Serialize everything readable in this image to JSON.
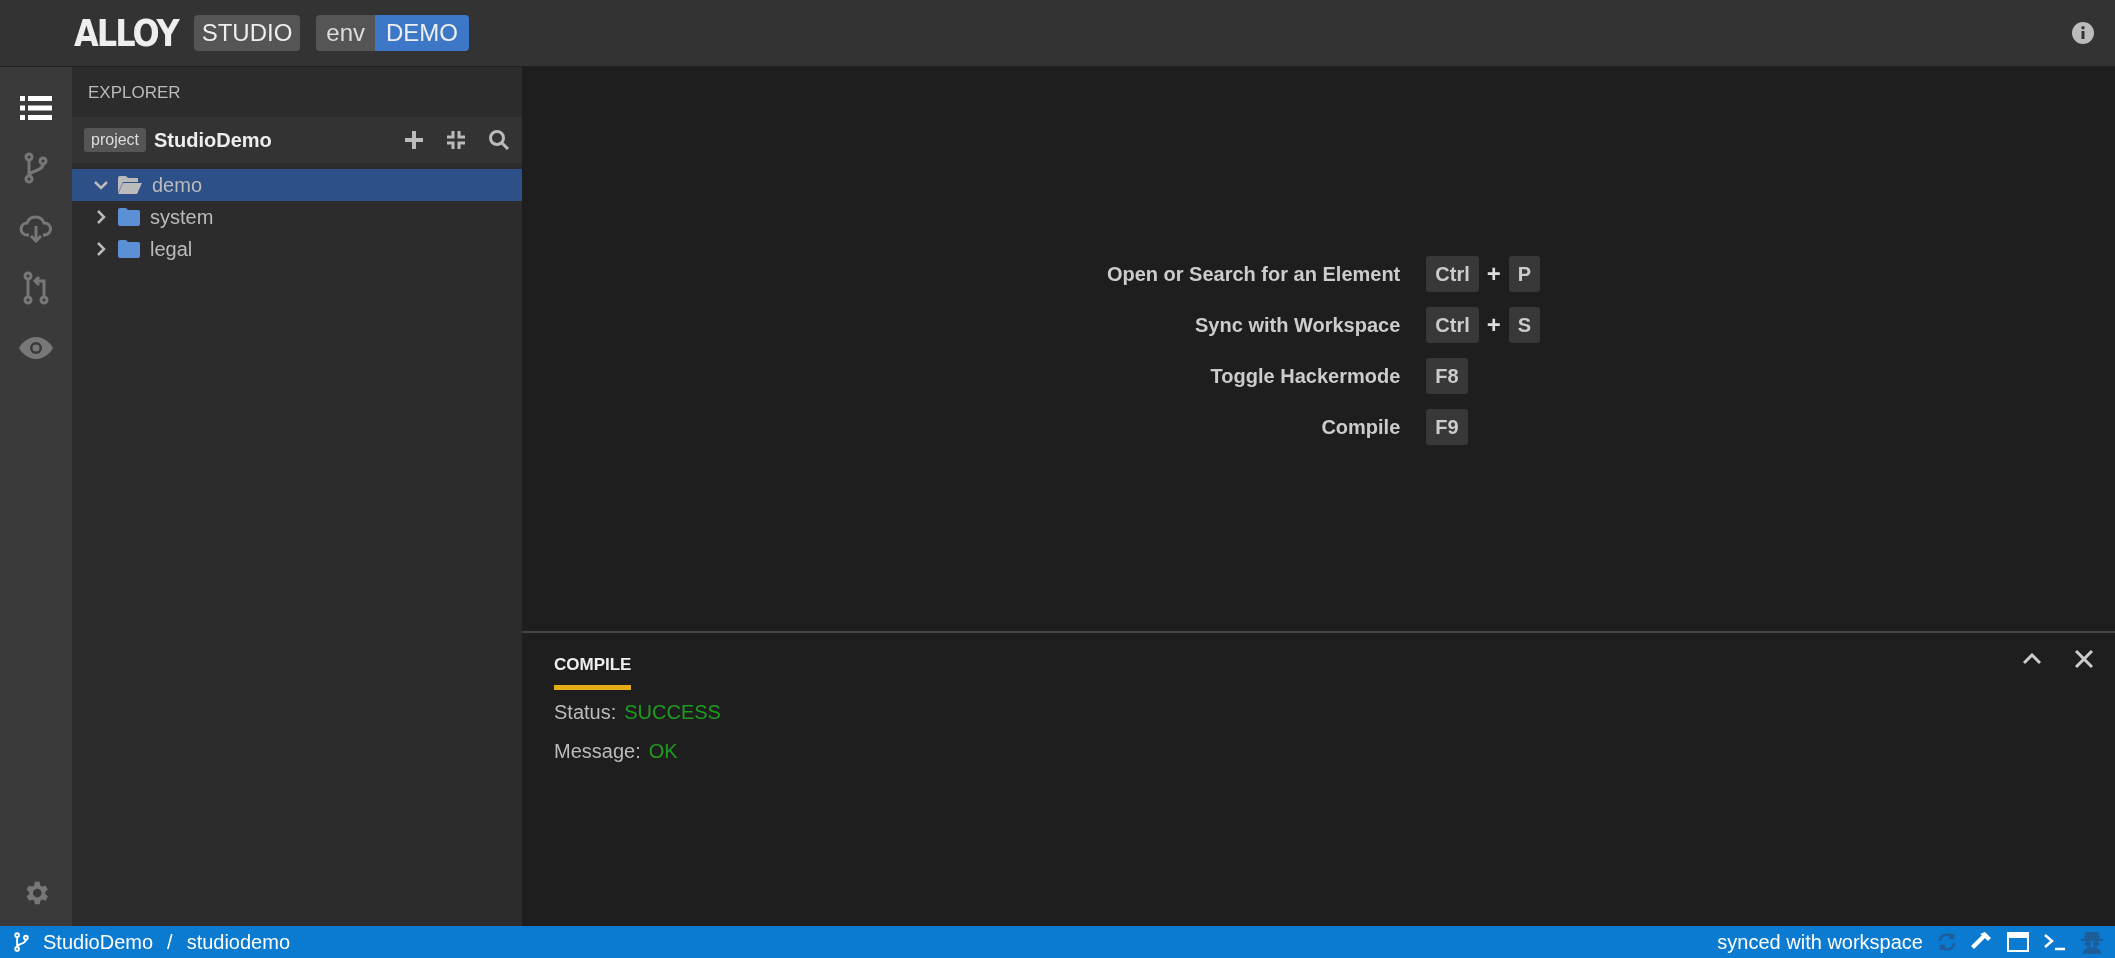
{
  "header": {
    "logo": "ALLOY",
    "product": "STUDIO",
    "env_label": "env",
    "env_name": "DEMO"
  },
  "activity_bar": [
    {
      "kind": "list",
      "selected": true
    },
    {
      "kind": "branch",
      "selected": false
    },
    {
      "kind": "cloud",
      "selected": false
    },
    {
      "kind": "pull",
      "selected": false
    },
    {
      "kind": "eye",
      "selected": false
    }
  ],
  "explorer": {
    "title": "EXPLORER",
    "project_tag": "project",
    "project_name": "StudioDemo",
    "tree": [
      {
        "label": "demo",
        "expanded": true,
        "selected": true
      },
      {
        "label": "system",
        "expanded": false,
        "selected": false
      },
      {
        "label": "legal",
        "expanded": false,
        "selected": false
      }
    ]
  },
  "shortcuts": [
    {
      "label": "Open or Search for an Element",
      "keys": [
        "Ctrl",
        "P"
      ],
      "joiner": "+"
    },
    {
      "label": "Sync with Workspace",
      "keys": [
        "Ctrl",
        "S"
      ],
      "joiner": "+"
    },
    {
      "label": "Toggle Hackermode",
      "keys": [
        "F8"
      ]
    },
    {
      "label": "Compile",
      "keys": [
        "F9"
      ]
    }
  ],
  "compile_panel": {
    "tab": "COMPILE",
    "fields": [
      {
        "label": "Status:",
        "value": "SUCCESS"
      },
      {
        "label": "Message:",
        "value": "OK"
      }
    ]
  },
  "status_bar": {
    "project": "StudioDemo",
    "separator": "/",
    "branch": "studiodemo",
    "sync": "synced with workspace"
  }
}
